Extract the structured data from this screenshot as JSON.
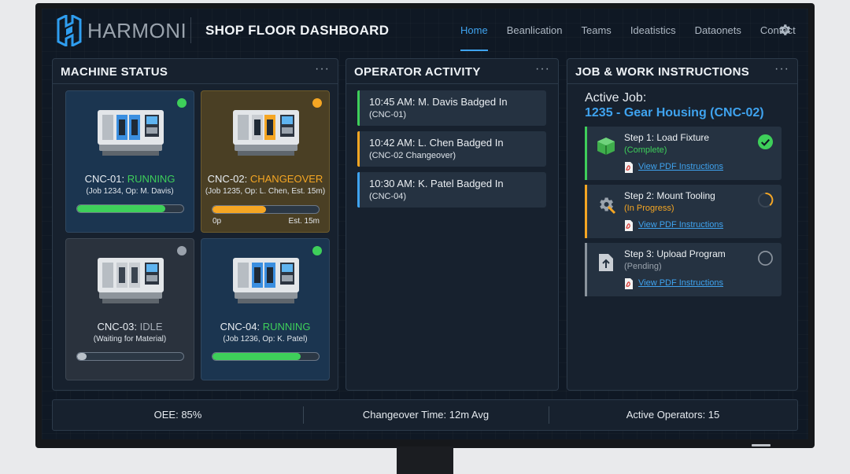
{
  "header": {
    "brand": "HARMONI",
    "dashboard_title": "SHOP FLOOR DASHBOARD",
    "nav": [
      {
        "label": "Home",
        "active": true
      },
      {
        "label": "Beanlication",
        "active": false
      },
      {
        "label": "Teams",
        "active": false
      },
      {
        "label": "Ideatistics",
        "active": false
      },
      {
        "label": "Dataonets",
        "active": false
      },
      {
        "label": "Contact",
        "active": false
      }
    ],
    "settings_icon": "gear-icon"
  },
  "machine_status": {
    "title": "MACHINE STATUS",
    "menu": "···",
    "machines": [
      {
        "name": "CNC-01:",
        "status": "RUNNING",
        "status_color": "#3ecf5a",
        "dot_color": "#3ecf5a",
        "detail": "(Job 1234, Op: M. Davis)",
        "progress": 0.83,
        "bar_color": "#3ecf5a"
      },
      {
        "name": "CNC-02:",
        "status": "CHANGEOVER",
        "status_color": "#f5a623",
        "dot_color": "#f5a623",
        "detail": "(Job 1235, Op: L. Chen, Est. 15m)",
        "progress": 0.5,
        "bar_color": "#f5a623",
        "bar_left": "0p",
        "bar_right": "Est. 15m"
      },
      {
        "name": "CNC-03:",
        "status": "IDLE",
        "status_color": "#a6aeb8",
        "dot_color": "#9aa2ac",
        "detail": "(Waiting for Material)",
        "progress": 0.09,
        "bar_color": "#b8c0c8"
      },
      {
        "name": "CNC-04:",
        "status": "RUNNING",
        "status_color": "#3ecf5a",
        "dot_color": "#3ecf5a",
        "detail": "(Job 1236, Op: K. Patel)",
        "progress": 0.83,
        "bar_color": "#3ecf5a"
      }
    ]
  },
  "operator_activity": {
    "title": "OPERATOR ACTIVITY",
    "menu": "···",
    "entries": [
      {
        "line1": "10:45 AM: M. Davis Badged In",
        "line2": "(CNC-01)",
        "color": "#3ecf5a"
      },
      {
        "line1": "10:42 AM: L. Chen Badged In",
        "line2": "(CNC-02 Changeover)",
        "color": "#f5a623"
      },
      {
        "line1": "10:30 AM: K. Patel Badged In",
        "line2": "(CNC-04)",
        "color": "#3fa3ef"
      }
    ]
  },
  "job_instructions": {
    "title": "JOB & WORK INSTRUCTIONS",
    "menu": "···",
    "active_job_label": "Active Job:",
    "active_job_name": "1235 - Gear Housing (CNC-02)",
    "steps": [
      {
        "title": "Step 1: Load Fixture",
        "status": "(Complete)",
        "status_color": "#3ecf5a",
        "bar_color": "#3ecf5a",
        "icon": "cube-fixture-icon",
        "state": "complete",
        "link": "View PDF Instructions"
      },
      {
        "title": "Step 2: Mount Tooling",
        "status": "(In Progress)",
        "status_color": "#f5a623",
        "bar_color": "#f5a623",
        "icon": "gear-wrench-icon",
        "state": "in-progress",
        "link": "View PDF Instructions"
      },
      {
        "title": "Step 3: Upload Program",
        "status": "(Pending)",
        "status_color": "#9aa3ad",
        "bar_color": "#8a939d",
        "icon": "upload-icon",
        "state": "pending",
        "link": "View PDF Instructions"
      }
    ]
  },
  "metrics": {
    "oee": "OEE: 85%",
    "changeover": "Changeover Time: 12m Avg",
    "operators": "Active Operators: 15"
  }
}
